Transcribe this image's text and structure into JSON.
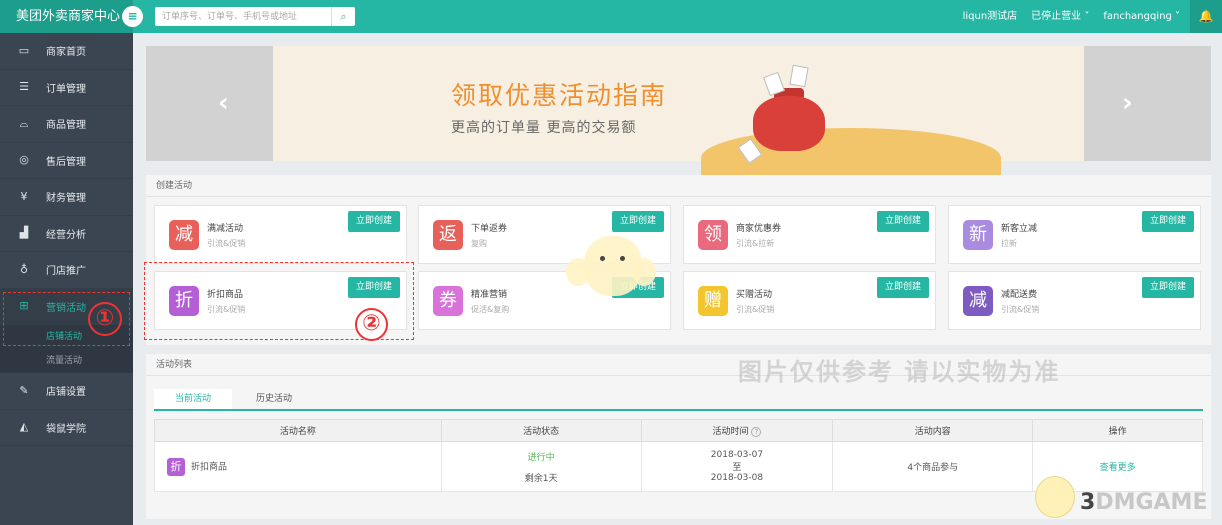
{
  "header": {
    "brand": "美团外卖商家中心",
    "search_placeholder": "订单序号、订单号、手机号或地址",
    "shop": "liqun测试店",
    "status": "已停止营业 ˅",
    "user": "fanchangqing ˅"
  },
  "sidebar": {
    "items": [
      {
        "label": "商家首页",
        "icon": "store-icon"
      },
      {
        "label": "订单管理",
        "icon": "clipboard-icon"
      },
      {
        "label": "商品管理",
        "icon": "bowl-icon"
      },
      {
        "label": "售后管理",
        "icon": "service-icon"
      },
      {
        "label": "财务管理",
        "icon": "yen-icon"
      },
      {
        "label": "经营分析",
        "icon": "chart-icon"
      },
      {
        "label": "门店推广",
        "icon": "bag-icon"
      },
      {
        "label": "营销活动",
        "icon": "gift-icon"
      }
    ],
    "sub_items": [
      "店铺活动",
      "流量活动"
    ],
    "bottom_items": [
      {
        "label": "店铺设置",
        "icon": "wrench-icon"
      },
      {
        "label": "袋鼠学院",
        "icon": "graduation-icon"
      }
    ],
    "annotation_number": "①"
  },
  "banner": {
    "title": "领取优惠活动指南",
    "subtitle": "更高的订单量  更高的交易额",
    "prev": "‹",
    "next": "›"
  },
  "create": {
    "title": "创建活动",
    "button_label": "立即创建",
    "annotation_number": "②",
    "cards": [
      {
        "icon": "减",
        "name": "满减活动",
        "desc": "引流&促销",
        "color": "#e8605a"
      },
      {
        "icon": "返",
        "name": "下单返券",
        "desc": "复购",
        "color": "#e8605a"
      },
      {
        "icon": "领",
        "name": "商家优惠券",
        "desc": "引流&拉新",
        "color": "#e86a7c"
      },
      {
        "icon": "新",
        "name": "新客立减",
        "desc": "拉新",
        "color": "#a98be0"
      },
      {
        "icon": "折",
        "name": "折扣商品",
        "desc": "引流&促销",
        "color": "#b45fd6"
      },
      {
        "icon": "券",
        "name": "精准营销",
        "desc": "促活&复购",
        "color": "#d972d9"
      },
      {
        "icon": "赠",
        "name": "买赠活动",
        "desc": "引流&促销",
        "color": "#f3c52f"
      },
      {
        "icon": "减",
        "name": "减配送费",
        "desc": "引流&促销",
        "color": "#7e5bc0"
      }
    ]
  },
  "list": {
    "title": "活动列表",
    "tabs": [
      "当前活动",
      "历史活动"
    ],
    "columns": [
      "活动名称",
      "活动状态",
      "活动时间",
      "活动内容",
      "操作"
    ],
    "rows": [
      {
        "icon": "折",
        "name": "折扣商品",
        "status": "进行中",
        "remaining": "剩余1天",
        "date_start": "2018-03-07",
        "date_sep": "至",
        "date_end": "2018-03-08",
        "content": "4个商品参与",
        "action": "查看更多"
      }
    ]
  },
  "watermark": {
    "text": "图片仅供参考 请以实物为准",
    "logo_a": "3",
    "logo_b": "DMGAME"
  }
}
